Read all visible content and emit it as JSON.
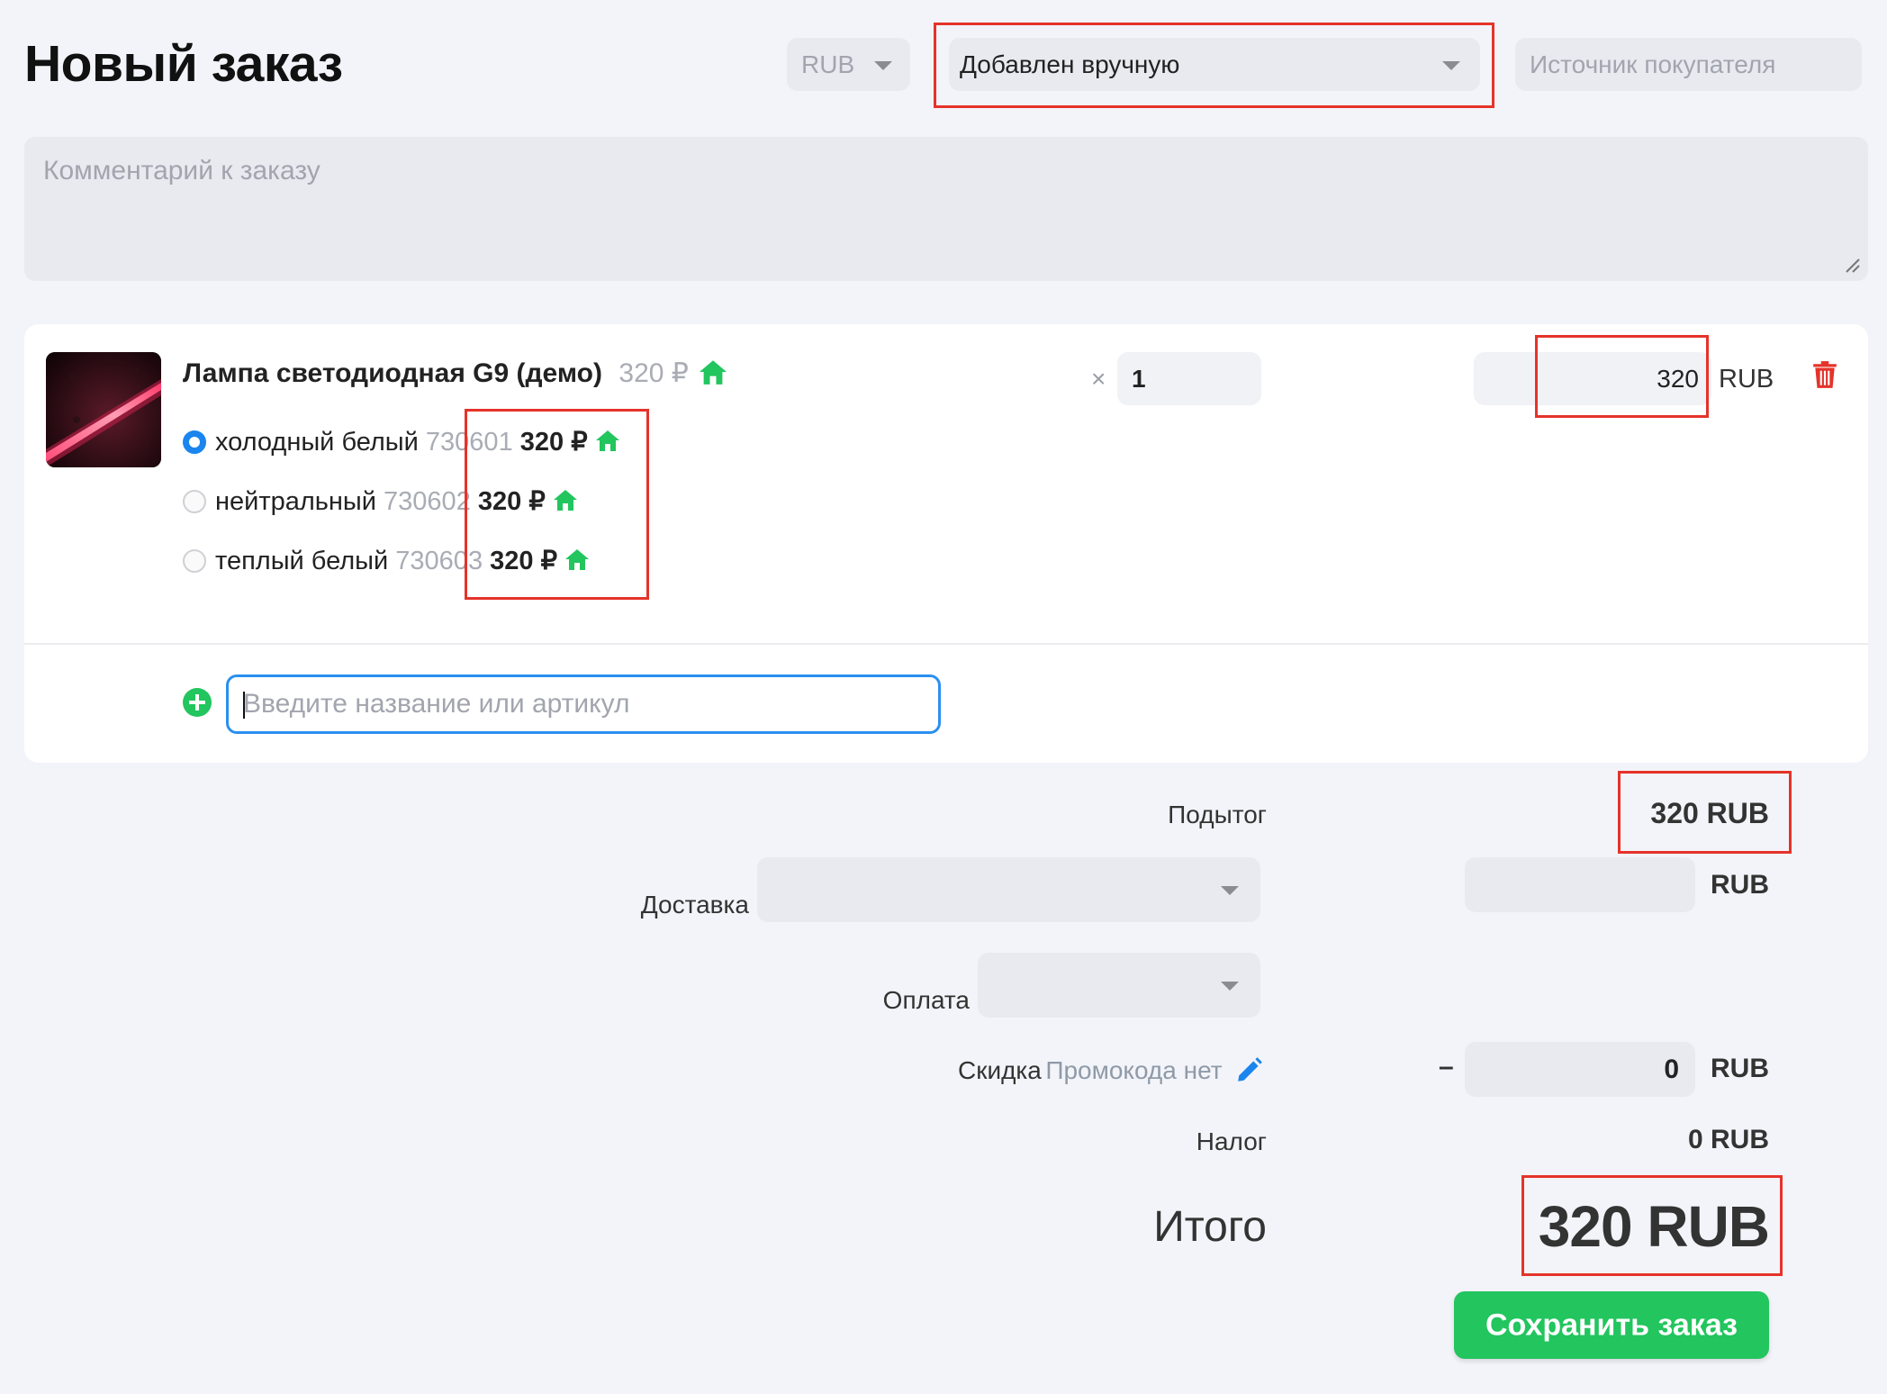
{
  "page": {
    "title": "Новый заказ"
  },
  "header": {
    "currency": "RUB",
    "source_type": "Добавлен вручную",
    "buyer_source_placeholder": "Источник покупателя"
  },
  "comment": {
    "placeholder": "Комментарий к заказу"
  },
  "item": {
    "name": "Лампа светодиодная G9 (демо)",
    "price": "320 ₽",
    "times": "×",
    "quantity": "1",
    "line_price": "320",
    "currency": "RUB",
    "variants": [
      {
        "label": "холодный белый",
        "sku": "730601",
        "price": "320 ₽",
        "selected": true
      },
      {
        "label": "нейтральный",
        "sku": "730602",
        "price": "320 ₽",
        "selected": false
      },
      {
        "label": "теплый белый",
        "sku": "730603",
        "price": "320 ₽",
        "selected": false
      }
    ]
  },
  "add_product": {
    "placeholder": "Введите название или артикул"
  },
  "totals": {
    "subtotal_label": "Подытог",
    "subtotal_value": "320 RUB",
    "shipping_label": "Доставка",
    "shipping_currency": "RUB",
    "payment_label": "Оплата",
    "discount_label": "Скидка",
    "promo_text": "Промокода нет",
    "discount_sign": "–",
    "discount_value": "0",
    "discount_currency": "RUB",
    "tax_label": "Налог",
    "tax_value": "0 RUB",
    "total_label": "Итого",
    "total_value": "320 RUB"
  },
  "actions": {
    "save_label": "Сохранить заказ"
  },
  "colors": {
    "accent_green": "#22c55e",
    "accent_blue": "#1a85ee",
    "delete_red": "#e5332a",
    "highlight_red": "#e5332a"
  }
}
